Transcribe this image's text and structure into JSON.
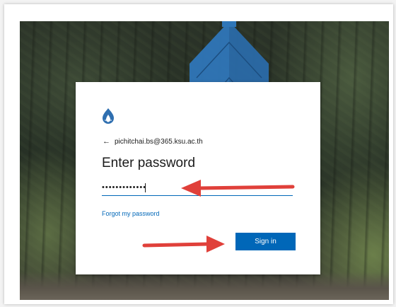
{
  "login": {
    "account_email": "pichitchai.bs@365.ksu.ac.th",
    "back_icon": "arrow-left-icon",
    "heading": "Enter password",
    "password_masked": "•••••••••••••",
    "forgot_link": "Forgot my password",
    "signin_label": "Sign in",
    "logo_icon": "university-flame-logo-icon"
  },
  "annotations": {
    "arrow_color": "#e0403a",
    "arrows": [
      "arrow-to-password-field",
      "arrow-to-sign-in-button"
    ]
  },
  "colors": {
    "accent": "#0067b8",
    "logo": "#2f6fb0"
  }
}
